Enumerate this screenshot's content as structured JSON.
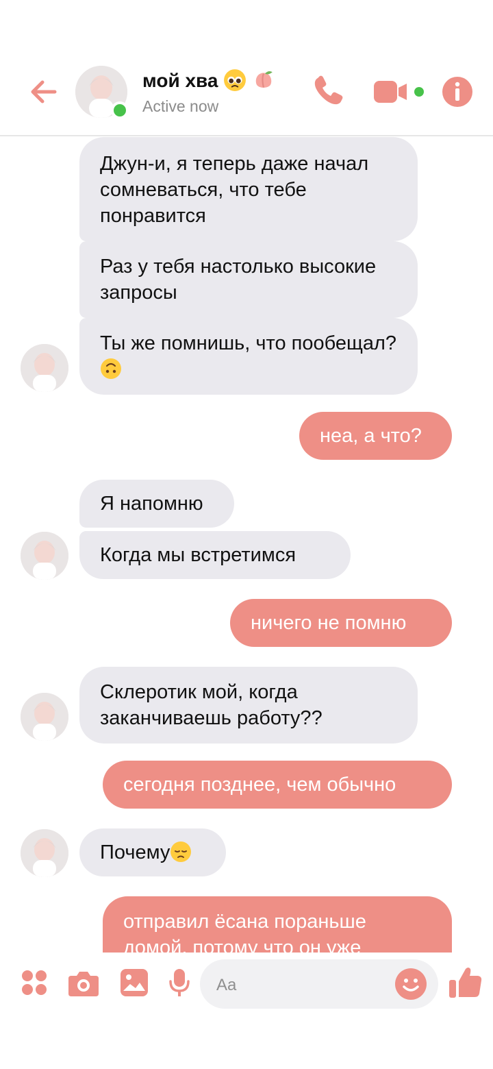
{
  "colors": {
    "accent": "#EE8F86",
    "incoming_bubble": "#EAE9EE",
    "online": "#47C24A"
  },
  "header": {
    "contact_name": "мой хва",
    "status": "Active now",
    "icons": [
      "back-arrow-icon",
      "call-icon",
      "video-call-icon",
      "info-icon"
    ],
    "name_emojis": [
      "pleading-face",
      "peach"
    ]
  },
  "messages": [
    {
      "side": "in",
      "text": "Джун-и, я теперь даже начал сомневаться, что тебе понравится"
    },
    {
      "side": "in",
      "text": "Раз у тебя настолько высокие запросы"
    },
    {
      "side": "in",
      "text": "Ты же помнишь, что пообещал?",
      "emoji": "upside-down-face"
    },
    {
      "side": "out",
      "text": "неа, а что?"
    },
    {
      "side": "in",
      "text": "Я напомню"
    },
    {
      "side": "in",
      "text": "Когда мы встретимся"
    },
    {
      "side": "out",
      "text": "ничего не помню"
    },
    {
      "side": "in",
      "text": "Склеротик мой, когда заканчиваешь работу??"
    },
    {
      "side": "out",
      "text": "сегодня позднее, чем обычно"
    },
    {
      "side": "in",
      "text": "Почему",
      "emoji": "pensive-face"
    },
    {
      "side": "out",
      "text": "отправил ёсана пораньше домой, потому что он уже"
    }
  ],
  "composer": {
    "placeholder": "Aa",
    "icons": [
      "more-apps-icon",
      "camera-icon",
      "gallery-icon",
      "mic-icon",
      "emoji-icon",
      "thumbs-up-icon"
    ]
  }
}
